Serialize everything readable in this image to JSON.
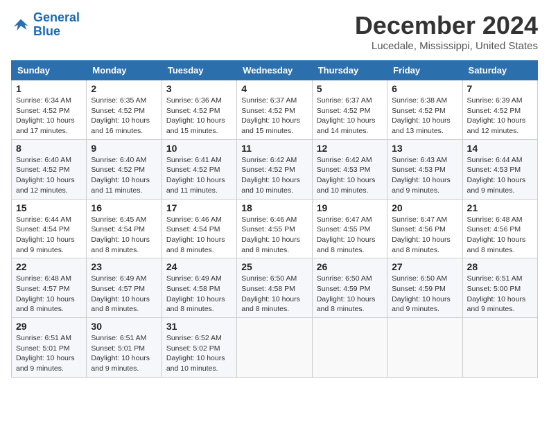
{
  "header": {
    "logo_line1": "General",
    "logo_line2": "Blue",
    "month_title": "December 2024",
    "location": "Lucedale, Mississippi, United States"
  },
  "weekdays": [
    "Sunday",
    "Monday",
    "Tuesday",
    "Wednesday",
    "Thursday",
    "Friday",
    "Saturday"
  ],
  "weeks": [
    [
      {
        "day": "1",
        "sunrise": "6:34 AM",
        "sunset": "4:52 PM",
        "daylight": "10 hours and 17 minutes."
      },
      {
        "day": "2",
        "sunrise": "6:35 AM",
        "sunset": "4:52 PM",
        "daylight": "10 hours and 16 minutes."
      },
      {
        "day": "3",
        "sunrise": "6:36 AM",
        "sunset": "4:52 PM",
        "daylight": "10 hours and 15 minutes."
      },
      {
        "day": "4",
        "sunrise": "6:37 AM",
        "sunset": "4:52 PM",
        "daylight": "10 hours and 15 minutes."
      },
      {
        "day": "5",
        "sunrise": "6:37 AM",
        "sunset": "4:52 PM",
        "daylight": "10 hours and 14 minutes."
      },
      {
        "day": "6",
        "sunrise": "6:38 AM",
        "sunset": "4:52 PM",
        "daylight": "10 hours and 13 minutes."
      },
      {
        "day": "7",
        "sunrise": "6:39 AM",
        "sunset": "4:52 PM",
        "daylight": "10 hours and 12 minutes."
      }
    ],
    [
      {
        "day": "8",
        "sunrise": "6:40 AM",
        "sunset": "4:52 PM",
        "daylight": "10 hours and 12 minutes."
      },
      {
        "day": "9",
        "sunrise": "6:40 AM",
        "sunset": "4:52 PM",
        "daylight": "10 hours and 11 minutes."
      },
      {
        "day": "10",
        "sunrise": "6:41 AM",
        "sunset": "4:52 PM",
        "daylight": "10 hours and 11 minutes."
      },
      {
        "day": "11",
        "sunrise": "6:42 AM",
        "sunset": "4:52 PM",
        "daylight": "10 hours and 10 minutes."
      },
      {
        "day": "12",
        "sunrise": "6:42 AM",
        "sunset": "4:53 PM",
        "daylight": "10 hours and 10 minutes."
      },
      {
        "day": "13",
        "sunrise": "6:43 AM",
        "sunset": "4:53 PM",
        "daylight": "10 hours and 9 minutes."
      },
      {
        "day": "14",
        "sunrise": "6:44 AM",
        "sunset": "4:53 PM",
        "daylight": "10 hours and 9 minutes."
      }
    ],
    [
      {
        "day": "15",
        "sunrise": "6:44 AM",
        "sunset": "4:54 PM",
        "daylight": "10 hours and 9 minutes."
      },
      {
        "day": "16",
        "sunrise": "6:45 AM",
        "sunset": "4:54 PM",
        "daylight": "10 hours and 8 minutes."
      },
      {
        "day": "17",
        "sunrise": "6:46 AM",
        "sunset": "4:54 PM",
        "daylight": "10 hours and 8 minutes."
      },
      {
        "day": "18",
        "sunrise": "6:46 AM",
        "sunset": "4:55 PM",
        "daylight": "10 hours and 8 minutes."
      },
      {
        "day": "19",
        "sunrise": "6:47 AM",
        "sunset": "4:55 PM",
        "daylight": "10 hours and 8 minutes."
      },
      {
        "day": "20",
        "sunrise": "6:47 AM",
        "sunset": "4:56 PM",
        "daylight": "10 hours and 8 minutes."
      },
      {
        "day": "21",
        "sunrise": "6:48 AM",
        "sunset": "4:56 PM",
        "daylight": "10 hours and 8 minutes."
      }
    ],
    [
      {
        "day": "22",
        "sunrise": "6:48 AM",
        "sunset": "4:57 PM",
        "daylight": "10 hours and 8 minutes."
      },
      {
        "day": "23",
        "sunrise": "6:49 AM",
        "sunset": "4:57 PM",
        "daylight": "10 hours and 8 minutes."
      },
      {
        "day": "24",
        "sunrise": "6:49 AM",
        "sunset": "4:58 PM",
        "daylight": "10 hours and 8 minutes."
      },
      {
        "day": "25",
        "sunrise": "6:50 AM",
        "sunset": "4:58 PM",
        "daylight": "10 hours and 8 minutes."
      },
      {
        "day": "26",
        "sunrise": "6:50 AM",
        "sunset": "4:59 PM",
        "daylight": "10 hours and 8 minutes."
      },
      {
        "day": "27",
        "sunrise": "6:50 AM",
        "sunset": "4:59 PM",
        "daylight": "10 hours and 9 minutes."
      },
      {
        "day": "28",
        "sunrise": "6:51 AM",
        "sunset": "5:00 PM",
        "daylight": "10 hours and 9 minutes."
      }
    ],
    [
      {
        "day": "29",
        "sunrise": "6:51 AM",
        "sunset": "5:01 PM",
        "daylight": "10 hours and 9 minutes."
      },
      {
        "day": "30",
        "sunrise": "6:51 AM",
        "sunset": "5:01 PM",
        "daylight": "10 hours and 9 minutes."
      },
      {
        "day": "31",
        "sunrise": "6:52 AM",
        "sunset": "5:02 PM",
        "daylight": "10 hours and 10 minutes."
      },
      null,
      null,
      null,
      null
    ]
  ]
}
